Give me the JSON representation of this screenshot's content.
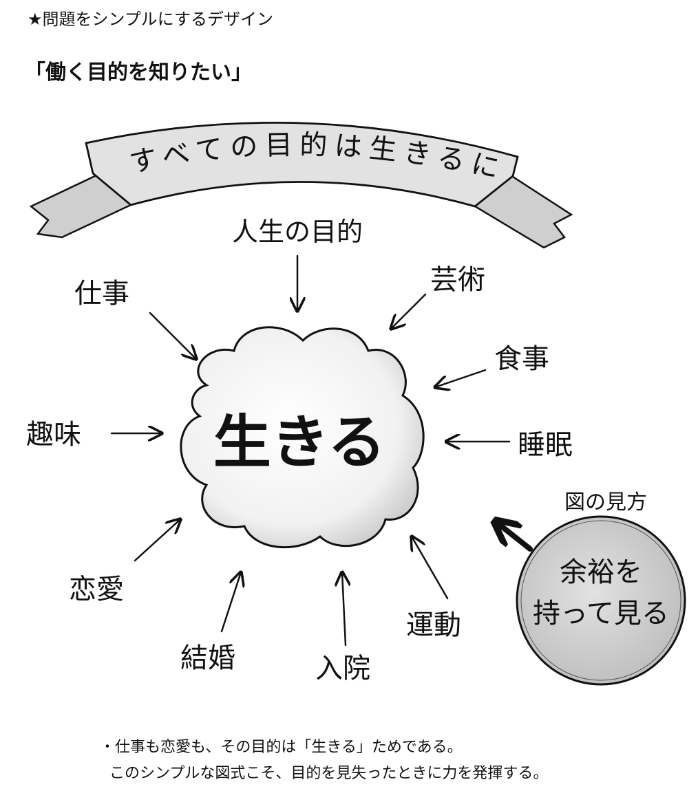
{
  "header": {
    "title": "★問題をシンプルにするデザイン"
  },
  "subtitle": "「働く目的を知りたい」",
  "diagram": {
    "banner": "すべての目的は生きるに",
    "center": "生きる",
    "labels": {
      "life_purpose": "人生の目的",
      "work": "仕事",
      "art": "芸術",
      "meal": "食事",
      "hobby": "趣味",
      "sleep": "睡眠",
      "love": "恋愛",
      "marriage": "結婚",
      "hospital": "入院",
      "exercise": "運動"
    },
    "legend": {
      "title": "図の見方",
      "circle_line1": "余裕を",
      "circle_line2": "持って見る"
    }
  },
  "caption": {
    "line1": "・仕事も恋愛も、その目的は「生きる」ためである。",
    "line2": "このシンプルな図式こそ、目的を見失ったときに力を発揮する。"
  },
  "colors": {
    "ink": "#111111",
    "banner_fill": "#d9d9d9",
    "cloud_fill": "#f2f2f2",
    "legend_fill": "#d4d4d4"
  }
}
